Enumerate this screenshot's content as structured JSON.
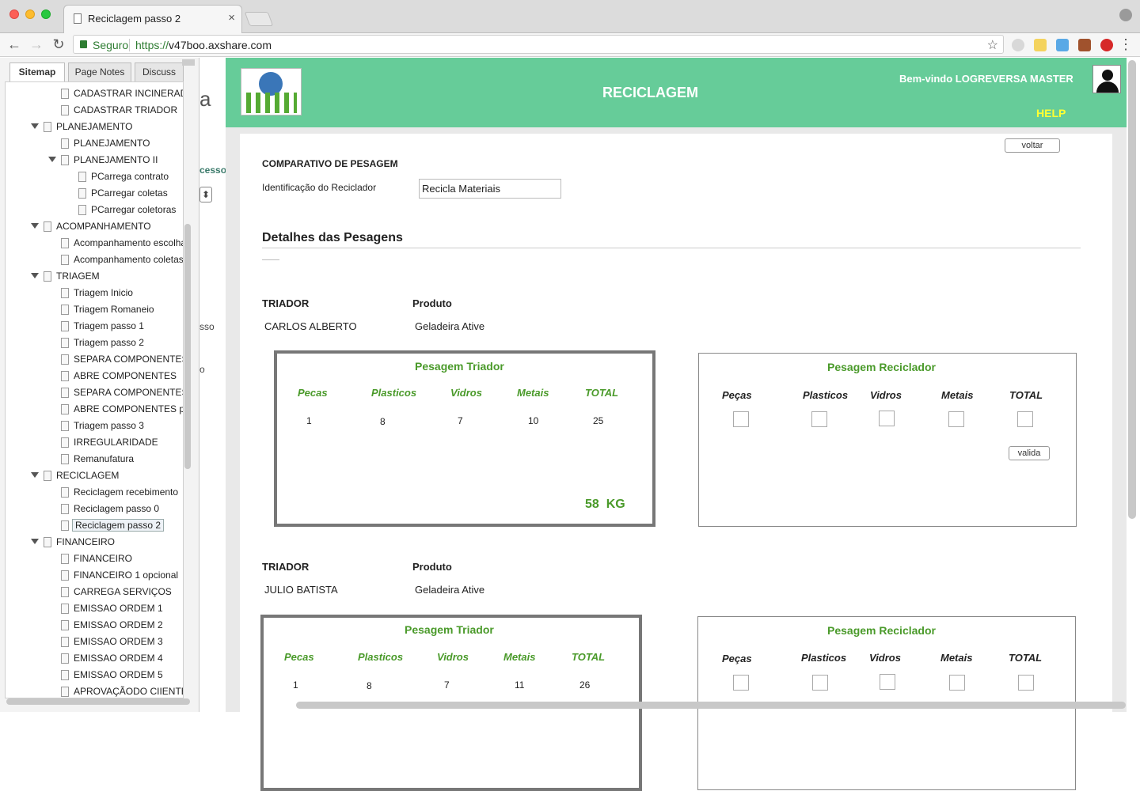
{
  "browser": {
    "tab_title": "Reciclagem passo 2",
    "tab_close": "×",
    "secure_label": "Seguro",
    "url_scheme": "https://",
    "url_host": "v47boo.axshare.com",
    "back": "←",
    "forward": "→",
    "reload": "↻",
    "star": "☆",
    "menu": "⋮"
  },
  "sidebar": {
    "tabs": [
      "Sitemap",
      "Page Notes",
      "Discuss"
    ],
    "items": [
      {
        "label": "CADASTRAR INCINERAD",
        "level": 1,
        "caret": false
      },
      {
        "label": "CADASTRAR TRIADOR",
        "level": 1,
        "caret": false
      },
      {
        "label": "PLANEJAMENTO",
        "level": 0,
        "caret": true
      },
      {
        "label": "PLANEJAMENTO",
        "level": 1,
        "caret": false
      },
      {
        "label": "PLANEJAMENTO II",
        "level": 1,
        "caret": true
      },
      {
        "label": "PCarrega contrato",
        "level": 2,
        "caret": false
      },
      {
        "label": "PCarregar coletas",
        "level": 2,
        "caret": false
      },
      {
        "label": "PCarregar coletoras",
        "level": 2,
        "caret": false
      },
      {
        "label": "ACOMPANHAMENTO",
        "level": 0,
        "caret": true
      },
      {
        "label": "Acompanhamento escolha",
        "level": 1,
        "caret": false
      },
      {
        "label": "Acompanhamento coletas",
        "level": 1,
        "caret": false
      },
      {
        "label": "TRIAGEM",
        "level": 0,
        "caret": true
      },
      {
        "label": "Triagem Inicio",
        "level": 1,
        "caret": false
      },
      {
        "label": "Triagem Romaneio",
        "level": 1,
        "caret": false
      },
      {
        "label": "Triagem passo 1",
        "level": 1,
        "caret": false
      },
      {
        "label": "Triagem passo 2",
        "level": 1,
        "caret": false
      },
      {
        "label": "SEPARA COMPONENTES",
        "level": 1,
        "caret": false
      },
      {
        "label": "ABRE COMPONENTES",
        "level": 1,
        "caret": false
      },
      {
        "label": "SEPARA COMPONENTES",
        "level": 1,
        "caret": false
      },
      {
        "label": "ABRE COMPONENTES p",
        "level": 1,
        "caret": false
      },
      {
        "label": "Triagem passo 3",
        "level": 1,
        "caret": false
      },
      {
        "label": "IRREGULARIDADE",
        "level": 1,
        "caret": false
      },
      {
        "label": "Remanufatura",
        "level": 1,
        "caret": false
      },
      {
        "label": "RECICLAGEM",
        "level": 0,
        "caret": true
      },
      {
        "label": "Reciclagem recebimento",
        "level": 1,
        "caret": false
      },
      {
        "label": "Reciclagem passo 0",
        "level": 1,
        "caret": false
      },
      {
        "label": "Reciclagem passo 2",
        "level": 1,
        "caret": false,
        "selected": true
      },
      {
        "label": "FINANCEIRO",
        "level": 0,
        "caret": true
      },
      {
        "label": "FINANCEIRO",
        "level": 1,
        "caret": false
      },
      {
        "label": "FINANCEIRO 1 opcional",
        "level": 1,
        "caret": false
      },
      {
        "label": "CARREGA SERVIÇOS",
        "level": 1,
        "caret": false
      },
      {
        "label": "EMISSAO ORDEM 1",
        "level": 1,
        "caret": false
      },
      {
        "label": "EMISSAO ORDEM 2",
        "level": 1,
        "caret": false
      },
      {
        "label": "EMISSAO ORDEM 3",
        "level": 1,
        "caret": false
      },
      {
        "label": "EMISSAO ORDEM 4",
        "level": 1,
        "caret": false
      },
      {
        "label": "EMISSAO ORDEM 5",
        "level": 1,
        "caret": false
      },
      {
        "label": "APROVAÇÃODO CIIENTE",
        "level": 1,
        "caret": false
      }
    ]
  },
  "fragments": {
    "a": "a",
    "cesso": "cesso",
    "sso": "sso",
    "o": "o",
    "spinner": "⬍"
  },
  "header": {
    "title": "RECICLAGEM",
    "welcome": "Bem-vindo LOGREVERSA MASTER",
    "help": "HELP"
  },
  "form": {
    "back_button": "voltar",
    "section_heading": "COMPARATIVO DE PESAGEM",
    "reciclador_label": "Identificação do Reciclador",
    "reciclador_value": "Recicla Materiais",
    "details_title": "Detalhes das Pesagens"
  },
  "entries": [
    {
      "triador_label": "TRIADOR",
      "produto_label": "Produto",
      "triador": "CARLOS ALBERTO",
      "produto": "Geladeira Ative",
      "triador_box": {
        "title": "Pesagem Triador",
        "headers": [
          "Pecas",
          "Plasticos",
          "Vidros",
          "Metais",
          "TOTAL"
        ],
        "values": [
          "1",
          "8",
          "7",
          "10",
          "25"
        ],
        "total_kg": "58  KG"
      },
      "reciclador_box": {
        "title": "Pesagem Reciclador",
        "headers": [
          "Peças",
          "Plasticos",
          "Vidros",
          "Metais",
          "TOTAL"
        ],
        "valida": "valida"
      }
    },
    {
      "triador_label": "TRIADOR",
      "produto_label": "Produto",
      "triador": "JULIO BATISTA",
      "produto": "Geladeira Ative",
      "triador_box": {
        "title": "Pesagem Triador",
        "headers": [
          "Pecas",
          "Plasticos",
          "Vidros",
          "Metais",
          "TOTAL"
        ],
        "values": [
          "1",
          "8",
          "7",
          "11",
          "26"
        ]
      },
      "reciclador_box": {
        "title": "Pesagem Reciclador",
        "headers": [
          "Peças",
          "Plasticos",
          "Vidros",
          "Metais",
          "TOTAL"
        ]
      }
    }
  ],
  "colors": {
    "header_green": "#66cc99",
    "label_green": "#4a9a2a",
    "help_yellow": "#ffff33"
  }
}
